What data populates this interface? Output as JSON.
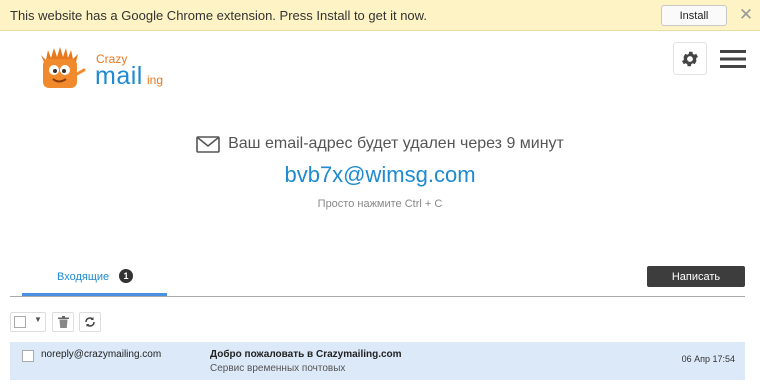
{
  "banner": {
    "text": "This website has a Google Chrome extension. Press Install to get it now.",
    "install_label": "Install",
    "close_glyph": "✕"
  },
  "logo": {
    "line1": "Crazy",
    "line2": "mail",
    "line3": "ing"
  },
  "header": {
    "settings_icon": "gear-icon",
    "menu_icon": "hamburger-menu-icon"
  },
  "main": {
    "expire_text": "Ваш email-адрес будет удален через 9 минут",
    "email": "bvb7x@wimsg.com",
    "hint": "Просто нажмите Ctrl + C"
  },
  "tabs": {
    "inbox_label": "Входящие",
    "inbox_count": "1",
    "compose_label": "Написать"
  },
  "messages": [
    {
      "from": "noreply@crazymailing.com",
      "subject": "Добро пожаловать в Crazymailing.com",
      "preview": "Сервис временных почтовых",
      "date": "06 Апр 17:54"
    }
  ],
  "colors": {
    "accent": "#1e8ad0",
    "banner_bg": "#fdf3c4",
    "selected_row": "#dbe9f8",
    "compose_bg": "#3d3d3d"
  }
}
